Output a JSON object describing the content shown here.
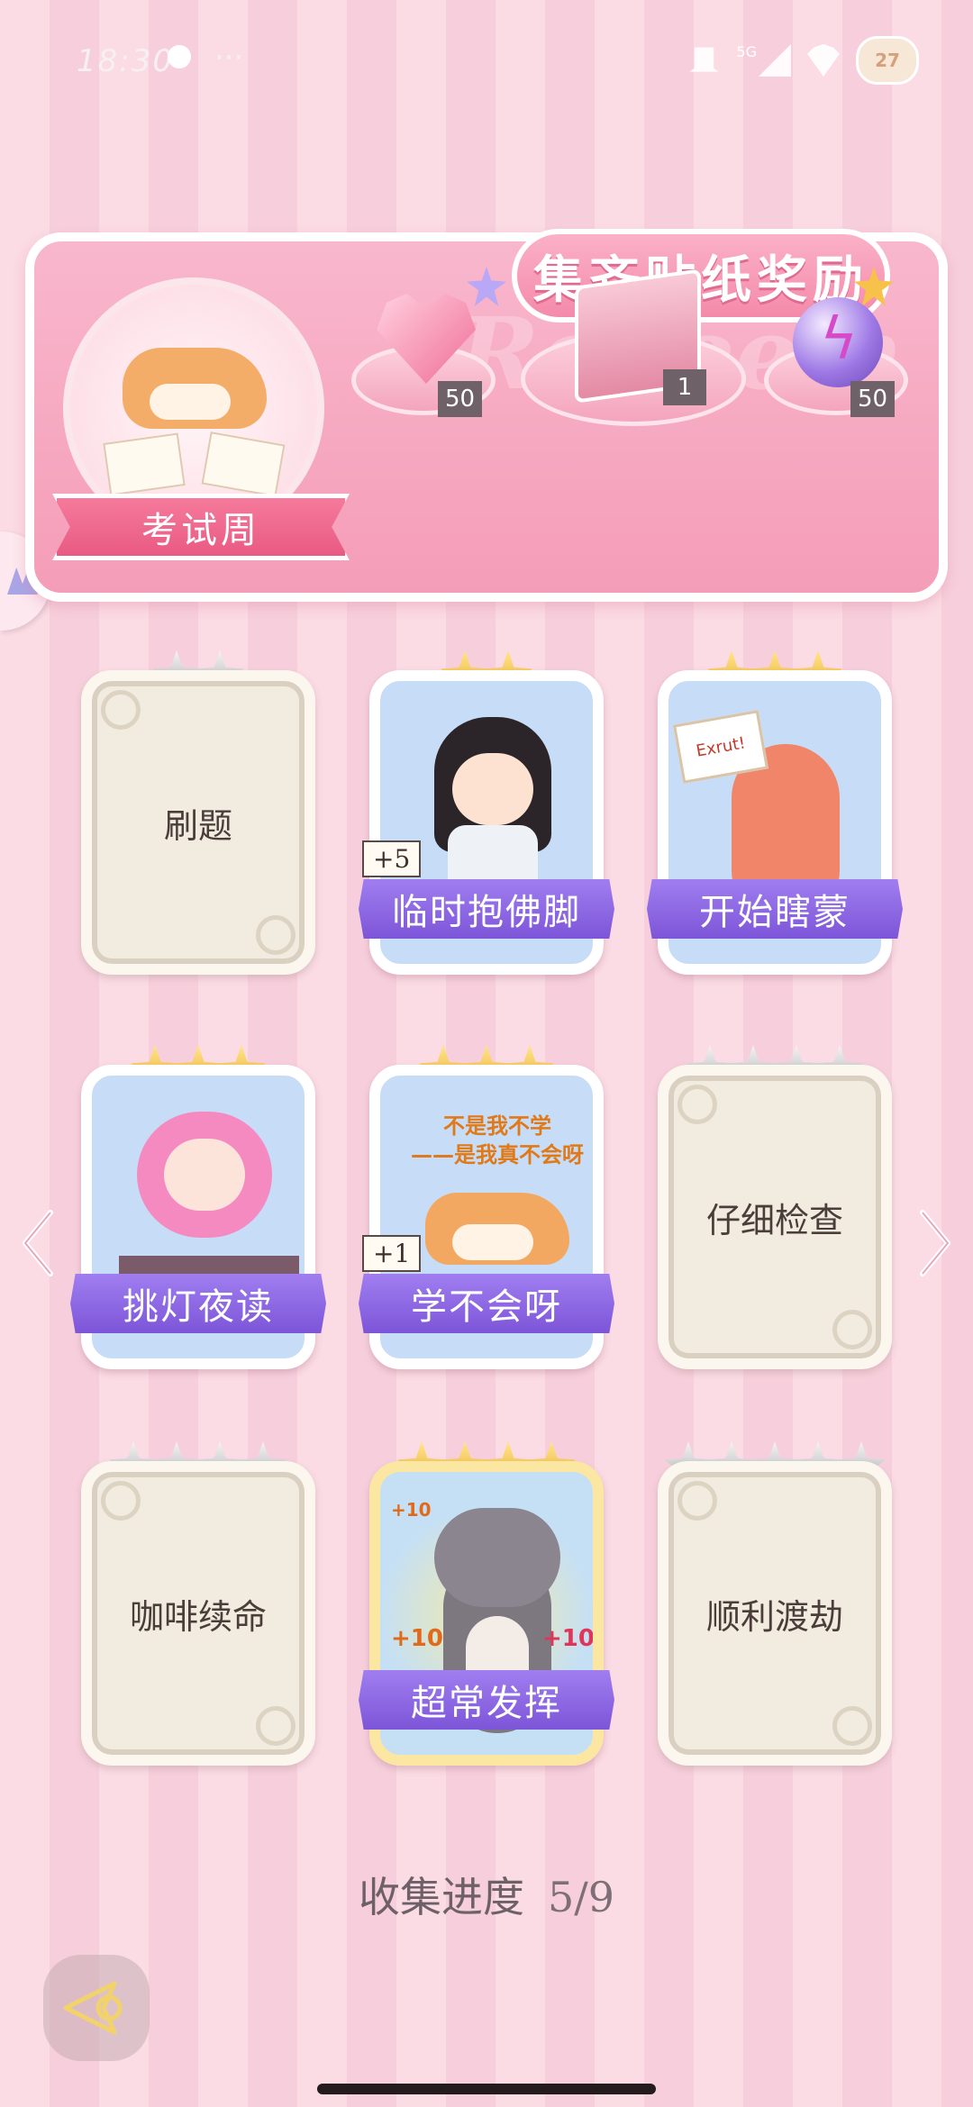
{
  "status_bar": {
    "time": "18:30",
    "more": "···",
    "battery": "27",
    "network": "5G"
  },
  "banner": {
    "title": "集齐贴纸奖励",
    "ghost_text": "Redeem",
    "exam_label": "考试周",
    "rewards": [
      {
        "icon": "heart-gem-icon",
        "count": "50"
      },
      {
        "icon": "gift-box-icon",
        "count": "1"
      },
      {
        "icon": "energy-orb-icon",
        "count": "50"
      }
    ]
  },
  "cards": [
    {
      "name": "刷题",
      "stars": 2,
      "star_color": "silver",
      "unlocked": false
    },
    {
      "name": "临时抱佛脚",
      "stars": 2,
      "star_color": "gold",
      "unlocked": true,
      "plus": "+5"
    },
    {
      "name": "开始瞎蒙",
      "stars": 3,
      "star_color": "gold",
      "unlocked": true,
      "sign_text": "Exrut!"
    },
    {
      "name": "挑灯夜读",
      "stars": 3,
      "star_color": "gold",
      "unlocked": true
    },
    {
      "name": "学不会呀",
      "stars": 3,
      "star_color": "gold",
      "unlocked": true,
      "plus": "+1",
      "art_text": [
        "不是我不学",
        "——是我真不会呀"
      ]
    },
    {
      "name": "仔细检查",
      "stars": 4,
      "star_color": "silver",
      "unlocked": false
    },
    {
      "name": "咖啡续命",
      "stars": 4,
      "star_color": "silver",
      "unlocked": false
    },
    {
      "name": "超常发挥",
      "stars": 4,
      "star_color": "gold",
      "unlocked": true,
      "bonus": [
        "+10",
        "+10",
        "+10"
      ]
    },
    {
      "name": "顺利渡劫",
      "stars": 5,
      "star_color": "silver",
      "unlocked": false
    }
  ],
  "progress": {
    "label": "收集进度",
    "value": "5/9"
  },
  "colors": {
    "accent_purple": "#8a62e0",
    "banner_pink": "#f59db8",
    "gold_star": "#e8a92b",
    "silver_star": "#a9a9a9"
  }
}
